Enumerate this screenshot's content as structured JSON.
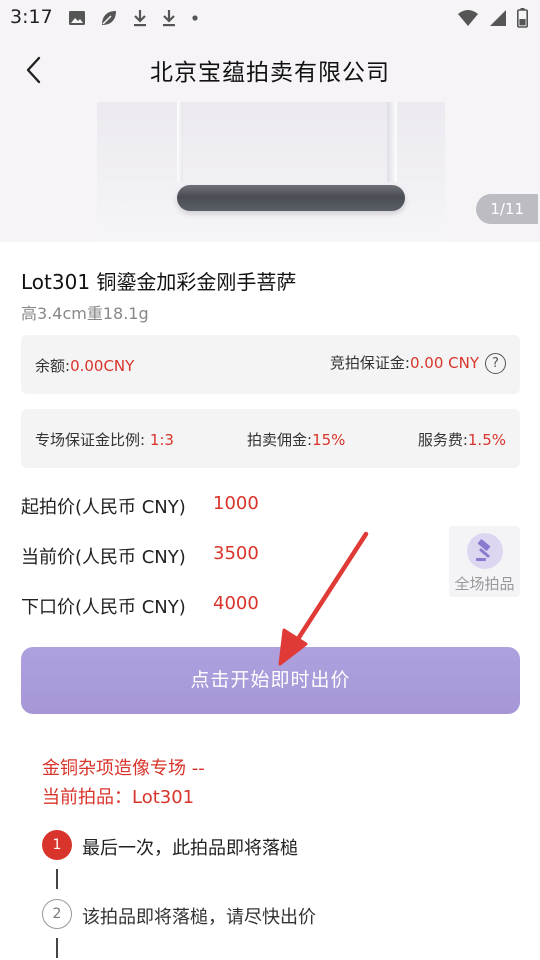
{
  "status_bar": {
    "time": "3:17",
    "left_icons": [
      "image-icon",
      "leaf-icon",
      "download-icon",
      "download-icon",
      "dot-icon"
    ],
    "right_icons": [
      "wifi-icon",
      "signal-icon",
      "battery-icon"
    ]
  },
  "header": {
    "title": "北京宝蕴拍卖有限公司",
    "back_icon": "chevron-left-icon"
  },
  "gallery": {
    "counter": "1/11"
  },
  "lot": {
    "title": "Lot301 铜鎏金加彩金刚手菩萨",
    "dimensions": "高3.4cm重18.1g"
  },
  "account": {
    "balance_label": "余额:",
    "balance_value": "0.00CNY",
    "deposit_label": "竞拍保证金:",
    "deposit_value": "0.00 CNY",
    "help_icon": "question-circle-icon"
  },
  "fees": {
    "ratio_label": "专场保证金比例: ",
    "ratio_value": "1:3",
    "commission_label": "拍卖佣金:",
    "commission_value": "15%",
    "service_label": "服务费:",
    "service_value": "1.5%"
  },
  "prices": {
    "start_label": "起拍价(人民币 CNY)",
    "start_value": "1000",
    "current_label": "当前价(人民币 CNY)",
    "current_value": "3500",
    "next_label": "下口价(人民币 CNY)",
    "next_value": "4000"
  },
  "all_lots": {
    "label": "全场拍品",
    "icon": "gavel-icon"
  },
  "bid_button": {
    "label": "点击开始即时出价"
  },
  "session": {
    "title": "金铜杂项造像专场 --",
    "current_lot": "当前拍品：Lot301"
  },
  "steps": [
    {
      "number": "1",
      "text": "最后一次，此拍品即将落槌"
    },
    {
      "number": "2",
      "text": "该拍品即将落槌，请尽快出价"
    }
  ],
  "colors": {
    "accent_red": "#d9342b",
    "button_purple": "#a99bdb",
    "annotation_arrow": "#e03a36"
  }
}
